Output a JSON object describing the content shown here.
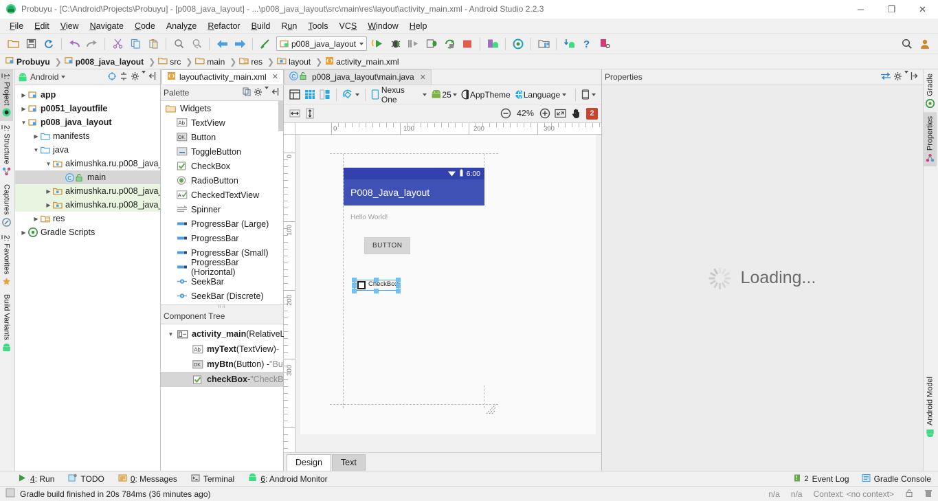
{
  "window": {
    "title": "Probuyu - [C:\\Android\\Projects\\Probuyu] - [p008_java_layout] - ...\\p008_java_layout\\src\\main\\res\\layout\\activity_main.xml - Android Studio 2.2.3",
    "minimize": "─",
    "maximize": "❐",
    "close": "✕"
  },
  "menubar": [
    {
      "label": "File",
      "accel": "F"
    },
    {
      "label": "Edit",
      "accel": "E"
    },
    {
      "label": "View",
      "accel": "V"
    },
    {
      "label": "Navigate",
      "accel": "N"
    },
    {
      "label": "Code",
      "accel": "C"
    },
    {
      "label": "Analyze",
      "accel": "z"
    },
    {
      "label": "Refactor",
      "accel": "R"
    },
    {
      "label": "Build",
      "accel": "B"
    },
    {
      "label": "Run",
      "accel": "u"
    },
    {
      "label": "Tools",
      "accel": "T"
    },
    {
      "label": "VCS",
      "accel": "S"
    },
    {
      "label": "Window",
      "accel": "W"
    },
    {
      "label": "Help",
      "accel": "H"
    }
  ],
  "toolbar": {
    "run_config": "p008_java_layout",
    "icons": [
      "open-folder-icon",
      "save-all-icon",
      "sync-icon",
      "undo-icon",
      "redo-icon",
      "cut-icon",
      "copy-icon",
      "paste-icon",
      "find-icon",
      "replace-icon",
      "back-icon",
      "forward-icon",
      "build-icon"
    ],
    "right_icons": [
      "run-icon",
      "debug-icon",
      "run-step-icon",
      "attach-debugger-icon",
      "rerun-icon",
      "stop-icon",
      "avd-manager-icon",
      "sync-gradle-icon",
      "project-structure-icon",
      "sdk-manager-icon",
      "help-icon",
      "device-monitor-icon"
    ]
  },
  "breadcrumb": [
    {
      "label": "Probuyu",
      "icon": "module-icon",
      "bold": true
    },
    {
      "label": "p008_java_layout",
      "icon": "module-icon",
      "bold": true
    },
    {
      "label": "src",
      "icon": "folder-icon",
      "bold": false
    },
    {
      "label": "main",
      "icon": "folder-icon",
      "bold": false
    },
    {
      "label": "res",
      "icon": "res-folder-icon",
      "bold": false
    },
    {
      "label": "layout",
      "icon": "layout-folder-icon",
      "bold": false
    },
    {
      "label": "activity_main.xml",
      "icon": "xml-file-icon",
      "bold": false
    }
  ],
  "left_tool_tabs": [
    {
      "label": "1: Project",
      "accel": "1",
      "icon": "project-icon",
      "selected": true
    },
    {
      "label": "2: Structure",
      "accel": "2",
      "icon": "structure-icon",
      "selected": false
    },
    {
      "label": "Captures",
      "accel": "",
      "icon": "captures-icon",
      "selected": false
    },
    {
      "label": "2: Favorites",
      "accel": "2",
      "icon": "favorites-star-icon",
      "selected": false
    },
    {
      "label": "Build Variants",
      "accel": "",
      "icon": "android-icon",
      "selected": false
    }
  ],
  "right_tool_tabs": [
    {
      "label": "Gradle",
      "icon": "gradle-icon",
      "selected": false
    },
    {
      "label": "Properties",
      "icon": "properties-icon",
      "selected": true
    },
    {
      "label": "Android Model",
      "icon": "android-icon",
      "selected": false
    }
  ],
  "project_panel": {
    "title": "Android",
    "actions": [
      "target-icon",
      "collapse-all-icon",
      "settings-gear-icon",
      "hide-panel-icon"
    ],
    "tree": [
      {
        "label": "app",
        "depth": 0,
        "arrow": "collapsed",
        "icon": "module-icon",
        "bold": true,
        "state": "normal"
      },
      {
        "label": "p0051_layoutfile",
        "depth": 0,
        "arrow": "collapsed",
        "icon": "module-icon",
        "bold": true,
        "state": "normal"
      },
      {
        "label": "p008_java_layout",
        "depth": 0,
        "arrow": "expanded",
        "icon": "module-icon",
        "bold": true,
        "state": "normal"
      },
      {
        "label": "manifests",
        "depth": 1,
        "arrow": "collapsed",
        "icon": "folder-blue-icon",
        "bold": false,
        "state": "normal"
      },
      {
        "label": "java",
        "depth": 1,
        "arrow": "expanded",
        "icon": "folder-blue-icon",
        "bold": false,
        "state": "normal"
      },
      {
        "label": "akimushka.ru.p008_java_",
        "depth": 2,
        "arrow": "expanded",
        "icon": "package-icon",
        "bold": false,
        "state": "normal"
      },
      {
        "label": "main",
        "depth": 3,
        "arrow": "none",
        "icon": "java-class-icon",
        "bold": false,
        "state": "selected"
      },
      {
        "label": "akimushka.ru.p008_java_",
        "depth": 2,
        "arrow": "collapsed",
        "icon": "package-icon",
        "bold": false,
        "state": "highlight"
      },
      {
        "label": "akimushka.ru.p008_java_",
        "depth": 2,
        "arrow": "collapsed",
        "icon": "package-icon",
        "bold": false,
        "state": "highlight"
      },
      {
        "label": "res",
        "depth": 1,
        "arrow": "collapsed",
        "icon": "res-folder-icon",
        "bold": false,
        "state": "normal"
      },
      {
        "label": "Gradle Scripts",
        "depth": 0,
        "arrow": "collapsed",
        "icon": "gradle-icon",
        "bold": false,
        "state": "normal"
      }
    ]
  },
  "editor_tabs": [
    {
      "label": "layout\\activity_main.xml",
      "icon": "xml-file-icon",
      "selected": true,
      "close": "✕"
    },
    {
      "label": "p008_java_layout\\main.java",
      "icon": "java-class-icon",
      "selected": false,
      "close": "✕"
    }
  ],
  "palette": {
    "title": "Palette",
    "actions": [
      "copy-icon",
      "settings-gear-icon",
      "hide-panel-icon"
    ],
    "group": "Widgets",
    "items": [
      {
        "label": "TextView",
        "icon": "textview-icon"
      },
      {
        "label": "Button",
        "icon": "button-icon"
      },
      {
        "label": "ToggleButton",
        "icon": "togglebutton-icon"
      },
      {
        "label": "CheckBox",
        "icon": "checkbox-icon"
      },
      {
        "label": "RadioButton",
        "icon": "radiobutton-icon"
      },
      {
        "label": "CheckedTextView",
        "icon": "checkedtextview-icon"
      },
      {
        "label": "Spinner",
        "icon": "spinner-icon"
      },
      {
        "label": "ProgressBar (Large)",
        "icon": "progressbar-icon"
      },
      {
        "label": "ProgressBar",
        "icon": "progressbar-icon"
      },
      {
        "label": "ProgressBar (Small)",
        "icon": "progressbar-icon"
      },
      {
        "label": "ProgressBar (Horizontal)",
        "icon": "progressbar-icon"
      },
      {
        "label": "SeekBar",
        "icon": "seekbar-icon"
      },
      {
        "label": "SeekBar (Discrete)",
        "icon": "seekbar-icon"
      }
    ]
  },
  "component_tree": {
    "title": "Component Tree",
    "rows": [
      {
        "name": "activity_main",
        "type": " (RelativeLa",
        "extra": "",
        "depth": 0,
        "arrow": "expanded",
        "icon": "relativelayout-icon",
        "selected": false
      },
      {
        "name": "myText",
        "type": " (TextView) ",
        "extra": "-",
        "depth": 1,
        "arrow": "none",
        "icon": "textview-icon",
        "selected": false
      },
      {
        "name": "myBtn",
        "type": " (Button) - ",
        "extra": "\"Bu",
        "depth": 1,
        "arrow": "none",
        "icon": "button-icon",
        "selected": false
      },
      {
        "name": "checkBox",
        "type": " - ",
        "extra": "\"CheckB",
        "depth": 1,
        "arrow": "none",
        "icon": "checkbox-icon",
        "selected": true
      }
    ]
  },
  "design_toolbar": {
    "view_icons": [
      "design-view-icon",
      "blueprint-view-icon",
      "both-views-icon"
    ],
    "orientation_label": "orientation-icon",
    "device": "Nexus One",
    "api_level": "25",
    "theme": "AppTheme",
    "language": "Language",
    "device_class_icon": "phone-icon",
    "constraint_icons": [
      "expand-horizontal-icon",
      "expand-vertical-icon"
    ],
    "zoom_out": "⊖",
    "zoom_level": "42%",
    "zoom_in": "⊕",
    "zoom_fit": "fit-screen-icon",
    "pan": "pan-hand-icon",
    "warnings_count": "2"
  },
  "canvas": {
    "ruler_h_labels": [
      "0",
      "100",
      "200",
      "300"
    ],
    "ruler_v_labels": [
      "0",
      "100",
      "200",
      "300"
    ],
    "device_preview": {
      "status_time": "6:00",
      "wifi_icon": "wifi-icon",
      "battery_icon": "battery-icon",
      "app_title": "P008_Java_layout",
      "hello_text": "Hello World!",
      "button_text": "BUTTON",
      "checkbox_text": "CheckBox"
    }
  },
  "editor_mode_tabs": [
    {
      "label": "Design",
      "selected": true
    },
    {
      "label": "Text",
      "selected": false
    }
  ],
  "properties_panel": {
    "title": "Properties",
    "actions": [
      "toggle-view-icon",
      "settings-gear-icon",
      "hide-panel-icon"
    ],
    "loading_text": "Loading..."
  },
  "bottom_tool_window_bar": {
    "left": [
      {
        "label": "4: Run",
        "accel": "4",
        "icon": "run-icon"
      },
      {
        "label": "TODO",
        "accel": "",
        "icon": "todo-icon"
      },
      {
        "label": "0: Messages",
        "accel": "0",
        "icon": "messages-icon"
      },
      {
        "label": "Terminal",
        "accel": "",
        "icon": "terminal-icon"
      },
      {
        "label": "6: Android Monitor",
        "accel": "6",
        "icon": "android-icon"
      }
    ],
    "right": [
      {
        "label": "Event Log",
        "badge": "2",
        "icon": "event-log-icon"
      },
      {
        "label": "Gradle Console",
        "badge": "",
        "icon": "gradle-console-icon"
      }
    ]
  },
  "statusbar": {
    "icon": "build-status-icon",
    "message": "Gradle build finished in 20s 784ms (36 minutes ago)",
    "right": [
      "n/a",
      "n/a",
      "Context: <no context>"
    ],
    "right_icons": [
      "lock-icon",
      "trash-icon"
    ]
  },
  "colors": {
    "accent_blue": "#3f51b5",
    "status_blue": "#3341ae",
    "selection_blue": "#6ec0f5",
    "warning_red": "#c9442e",
    "selected_gray": "#d6d6d6",
    "highlight_green": "#eaf5e1"
  }
}
